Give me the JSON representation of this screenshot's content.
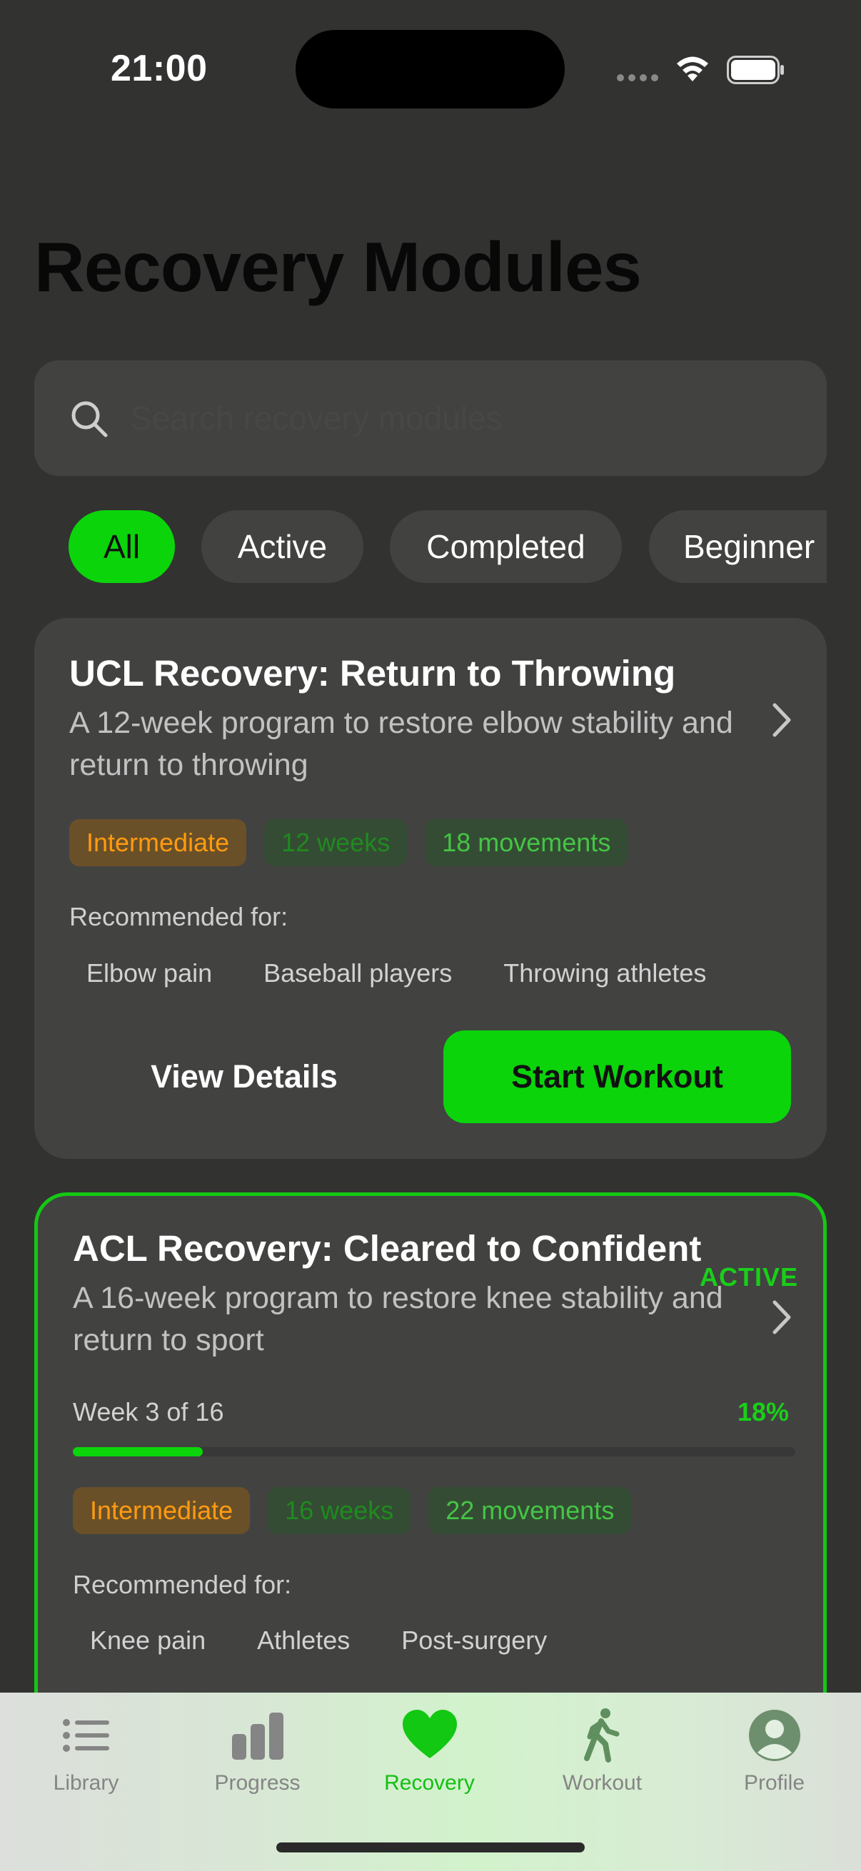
{
  "status_bar": {
    "time": "21:00"
  },
  "page": {
    "title": "Recovery Modules"
  },
  "search": {
    "placeholder": "Search recovery modules"
  },
  "filters": [
    "All",
    "Active",
    "Completed",
    "Beginner"
  ],
  "selected_filter": "All",
  "modules": [
    {
      "title": "UCL Recovery: Return to Throwing",
      "description": "A 12-week program to restore elbow stability and return to throwing",
      "level": "Intermediate",
      "duration": "12 weeks",
      "movements": "18 movements",
      "recommended_label": "Recommended for:",
      "recommended": [
        "Elbow pain",
        "Baseball players",
        "Throwing athletes"
      ],
      "details_label": "View Details",
      "start_label": "Start Workout"
    },
    {
      "title": "ACL Recovery: Cleared to Confident",
      "badge": "ACTIVE",
      "description": "A 16-week program to restore knee stability and return to sport",
      "progress_text": "Week 3 of 16",
      "progress_percent_text": "18%",
      "progress_fraction": 0.18,
      "level": "Intermediate",
      "duration": "16 weeks",
      "movements": "22 movements",
      "recommended_label": "Recommended for:",
      "recommended": [
        "Knee pain",
        "Athletes",
        "Post-surgery"
      ]
    }
  ],
  "tabbar": {
    "items": [
      {
        "label": "Library",
        "icon": "list-icon"
      },
      {
        "label": "Progress",
        "icon": "bar-chart-icon"
      },
      {
        "label": "Recovery",
        "icon": "heart-icon"
      },
      {
        "label": "Workout",
        "icon": "walking-figure-icon"
      },
      {
        "label": "Profile",
        "icon": "person-circle-icon"
      }
    ],
    "selected": "Recovery"
  },
  "colors": {
    "accent": "#0bd40b",
    "background": "#323231",
    "card": "#424241",
    "intermediate": "#ff9b10"
  }
}
